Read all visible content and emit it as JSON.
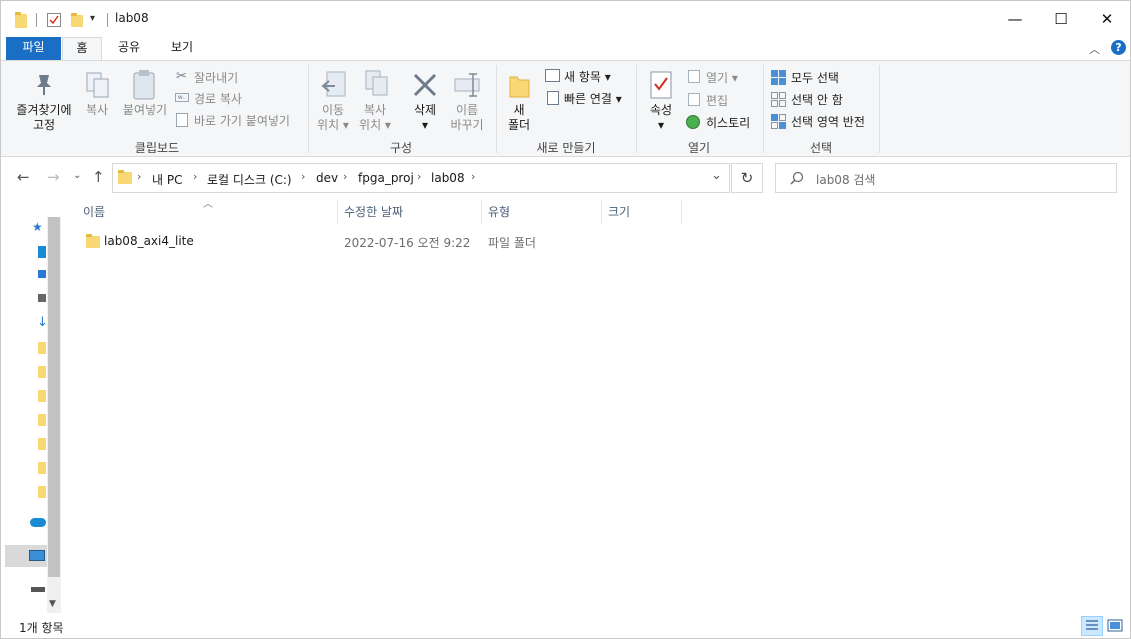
{
  "window": {
    "title": "lab08",
    "controls": {
      "minimize": "—",
      "maximize": "☐",
      "close": "✕"
    }
  },
  "tabs": [
    {
      "label": "파일"
    },
    {
      "label": "홈"
    },
    {
      "label": "공유"
    },
    {
      "label": "보기"
    }
  ],
  "ribbon": {
    "clipboard": {
      "pin_label": "즐겨찾기에\n고정",
      "copy_label": "복사",
      "paste_label": "붙여넣기",
      "cut_label": "잘라내기",
      "copy_path_label": "경로 복사",
      "paste_shortcut_label": "바로 가기 붙여넣기",
      "group_label": "클립보드"
    },
    "organize": {
      "move_label": "이동\n위치 ▾",
      "copy_to_label": "복사\n위치 ▾",
      "delete_label": "삭제\n▾",
      "rename_label": "이름\n바꾸기",
      "group_label": "구성"
    },
    "new": {
      "new_folder_label": "새\n폴더",
      "new_item_label": "새 항목 ▾",
      "easy_access_label": "빠른 연결 ▾",
      "group_label": "새로 만들기"
    },
    "open": {
      "properties_label": "속성\n▾",
      "open_label": "열기 ▾",
      "edit_label": "편집",
      "history_label": "히스토리",
      "group_label": "열기"
    },
    "select": {
      "select_all_label": "모두 선택",
      "select_none_label": "선택 안 함",
      "invert_label": "선택 영역 반전",
      "group_label": "선택"
    }
  },
  "address": {
    "breadcrumbs": [
      "내 PC",
      "로컬 디스크 (C:)",
      "dev",
      "fpga_proj",
      "lab08"
    ],
    "search_placeholder": "lab08 검색"
  },
  "columns": {
    "name": "이름",
    "modified": "수정한 날짜",
    "type": "유형",
    "size": "크기"
  },
  "files": [
    {
      "name": "lab08_axi4_lite",
      "modified": "2022-07-16 오전 9:22",
      "type": "파일 폴더",
      "size": ""
    }
  ],
  "status": {
    "item_count": "1개 항목"
  },
  "colors": {
    "accent": "#1a6fc4",
    "folder": "#f8d775",
    "selection": "#cce8ff"
  }
}
